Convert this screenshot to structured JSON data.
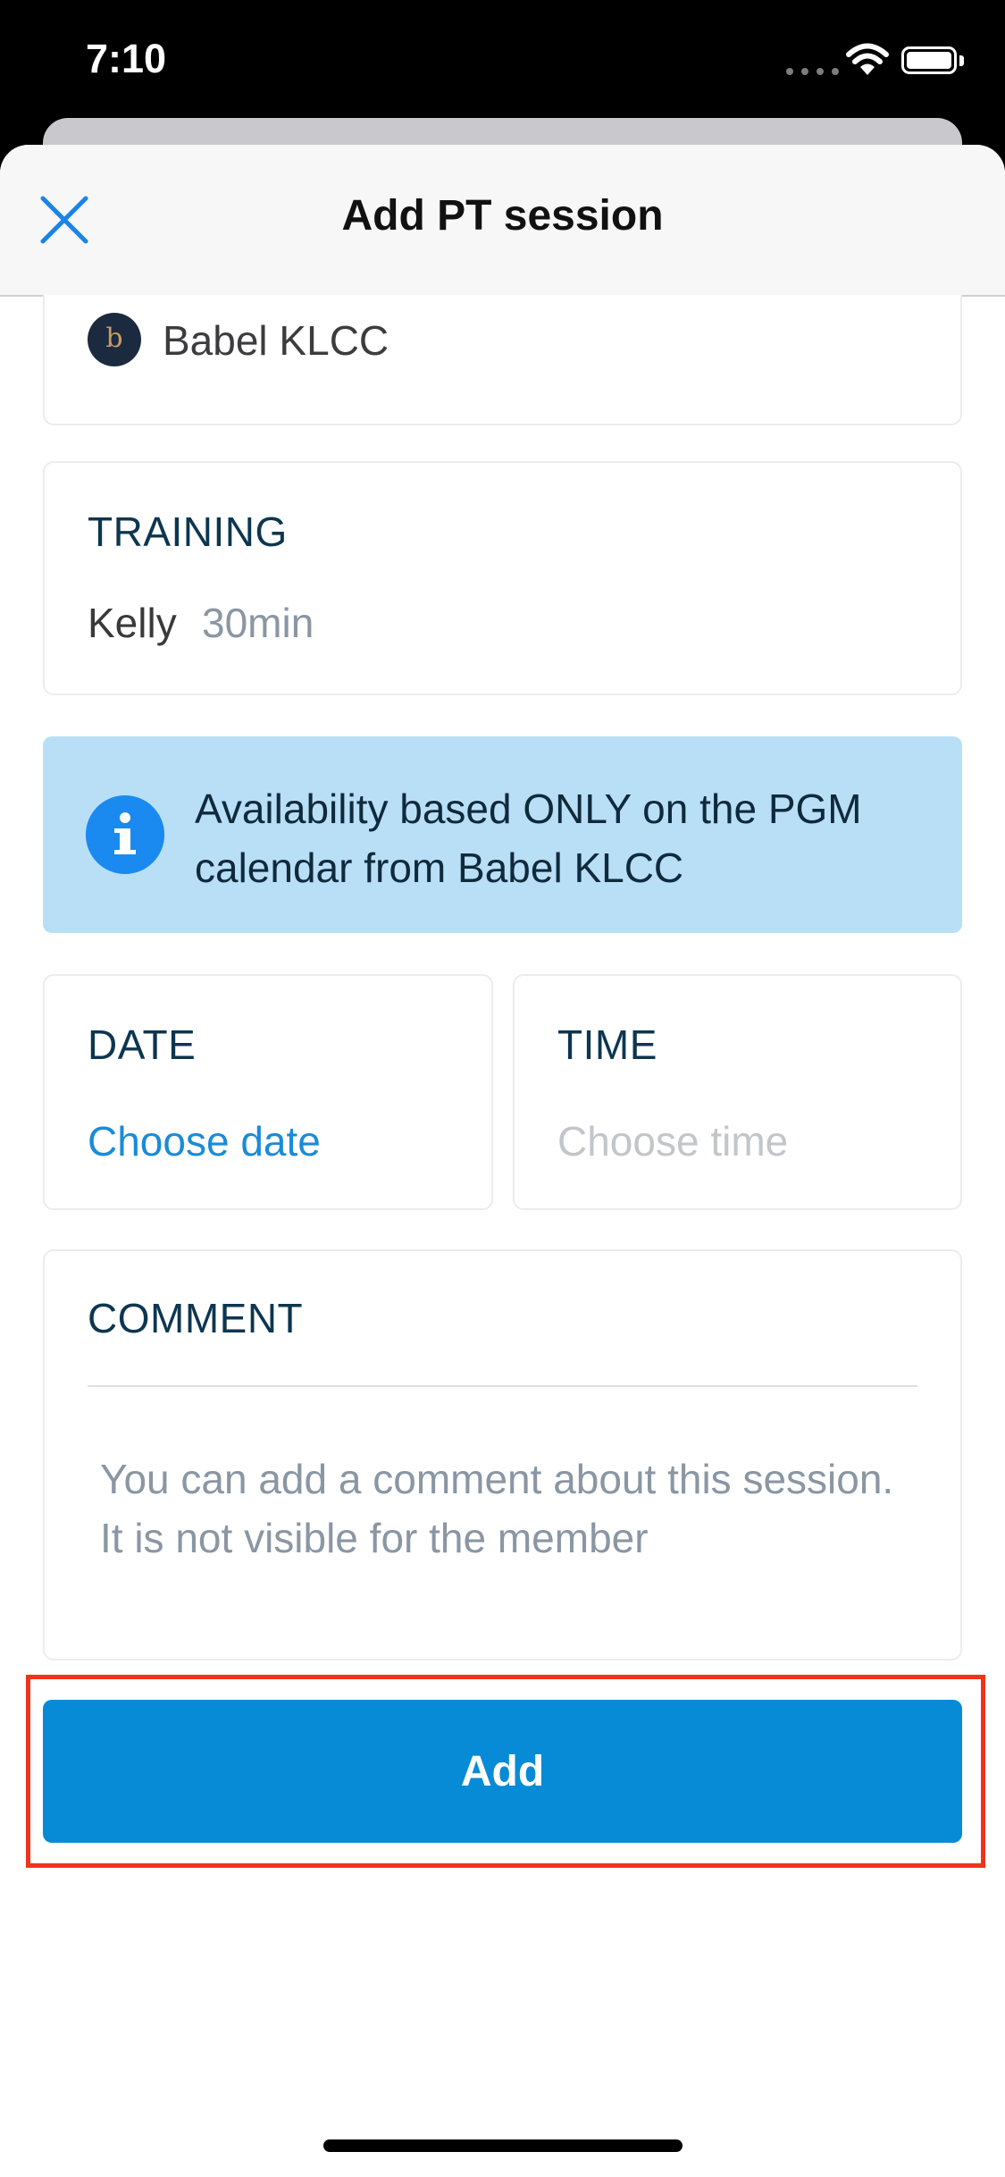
{
  "status_bar": {
    "time": "7:10"
  },
  "header": {
    "title": "Add PT session",
    "close_icon": "close-icon"
  },
  "gym": {
    "name": "Babel KLCC",
    "logo_letter": "b"
  },
  "training": {
    "label": "TRAINING",
    "trainer": "Kelly",
    "duration": "30min"
  },
  "info_banner": {
    "icon": "info-icon",
    "text": "Availability based ONLY on the PGM calendar from Babel KLCC"
  },
  "date": {
    "label": "DATE",
    "value": "Choose date"
  },
  "time": {
    "label": "TIME",
    "value": "Choose time"
  },
  "comment": {
    "label": "COMMENT",
    "placeholder": "You can add a comment about this session. It is not visible for the member"
  },
  "actions": {
    "add_label": "Add"
  },
  "colors": {
    "accent": "#078bd6",
    "info_bg": "#b9dff6",
    "highlight": "#f0331d"
  }
}
